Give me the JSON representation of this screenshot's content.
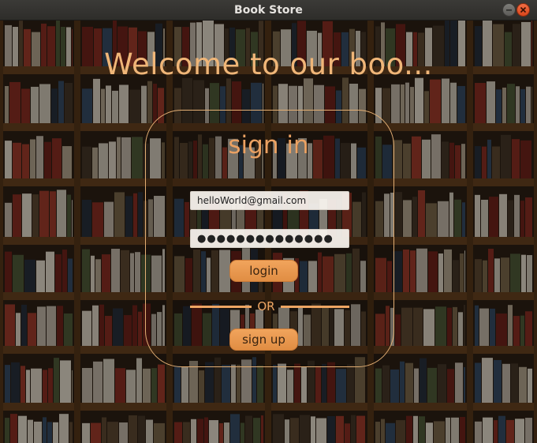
{
  "window": {
    "title": "Book Store"
  },
  "page": {
    "welcome": "Welcome to our boo...",
    "signin_title": "sign in",
    "email_value": "helloWorld@gmail.com",
    "password_mask": "●●●●●●●●●●●●●●",
    "login_label": "login",
    "or_label": "OR",
    "signup_label": "sign up"
  },
  "colors": {
    "accent": "#eda563",
    "title_text": "#f0b678",
    "panel_border": "#e3ae73",
    "close_button": "#e5531f"
  },
  "icons": [
    "minimize-icon",
    "close-icon"
  ]
}
